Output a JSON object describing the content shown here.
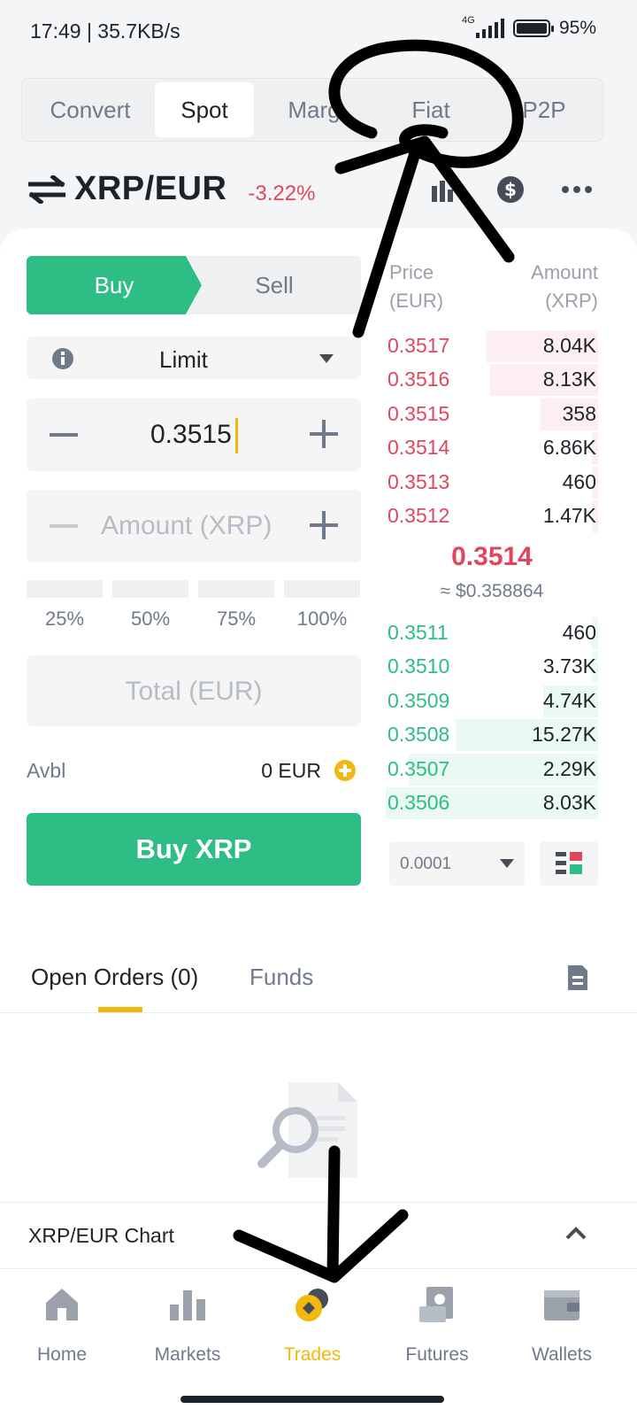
{
  "status_bar": {
    "left": "17:49 | 35.7KB/s",
    "network": "4G",
    "battery": "95%"
  },
  "top_tabs": [
    {
      "label": "Convert",
      "active": false
    },
    {
      "label": "Spot",
      "active": true
    },
    {
      "label": "Marg",
      "active": false
    },
    {
      "label": "Fiat",
      "active": false
    },
    {
      "label": "P2P",
      "active": false
    }
  ],
  "pair": {
    "name": "XRP/EUR",
    "change": "-3.22%"
  },
  "trade_form": {
    "buy_label": "Buy",
    "sell_label": "Sell",
    "order_type": "Limit",
    "price_value": "0.3515",
    "amount_placeholder": "Amount (XRP)",
    "percentages": [
      "25%",
      "50%",
      "75%",
      "100%"
    ],
    "total_placeholder": "Total (EUR)",
    "avbl_label": "Avbl",
    "avbl_value": "0 EUR",
    "buy_button": "Buy XRP"
  },
  "order_book": {
    "price_header_1": "Price",
    "price_header_2": "(EUR)",
    "amount_header_1": "Amount",
    "amount_header_2": "(XRP)",
    "asks": [
      {
        "price": "0.3517",
        "amount": "8.04K",
        "depth": 0.53
      },
      {
        "price": "0.3516",
        "amount": "8.13K",
        "depth": 0.51
      },
      {
        "price": "0.3515",
        "amount": "358",
        "depth": 0.27
      },
      {
        "price": "0.3514",
        "amount": "6.86K",
        "depth": 0.03
      },
      {
        "price": "0.3513",
        "amount": "460",
        "depth": 0.03
      },
      {
        "price": "0.3512",
        "amount": "1.47K",
        "depth": 0.03
      }
    ],
    "mid_price": "0.3514",
    "mid_usd": "≈ $0.358864",
    "bids": [
      {
        "price": "0.3511",
        "amount": "460",
        "depth": 0.03
      },
      {
        "price": "0.3510",
        "amount": "3.73K",
        "depth": 0.03
      },
      {
        "price": "0.3509",
        "amount": "4.74K",
        "depth": 0.26
      },
      {
        "price": "0.3508",
        "amount": "15.27K",
        "depth": 0.67
      },
      {
        "price": "0.3507",
        "amount": "2.29K",
        "depth": 0.89
      },
      {
        "price": "0.3506",
        "amount": "8.03K",
        "depth": 1.0
      }
    ],
    "precision": "0.0001"
  },
  "orders": {
    "open_orders_label": "Open Orders (0)",
    "funds_label": "Funds"
  },
  "chart_row": {
    "label": "XRP/EUR Chart"
  },
  "bottom_nav": [
    {
      "label": "Home",
      "icon": "home-icon",
      "active": false
    },
    {
      "label": "Markets",
      "icon": "markets-icon",
      "active": false
    },
    {
      "label": "Trades",
      "icon": "trades-icon",
      "active": true
    },
    {
      "label": "Futures",
      "icon": "futures-icon",
      "active": false
    },
    {
      "label": "Wallets",
      "icon": "wallets-icon",
      "active": false
    }
  ],
  "colors": {
    "green": "#2ebd85",
    "red": "#e0475e",
    "yellow": "#f0b90b",
    "text": "#1e2329",
    "muted": "#707a8a"
  }
}
